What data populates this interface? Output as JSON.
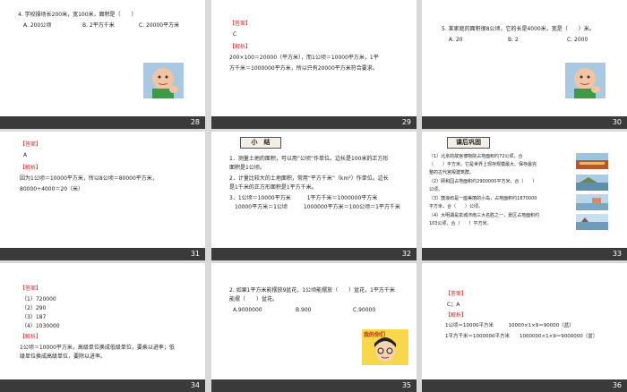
{
  "slides": [
    {
      "number": "28",
      "lines": [
        "4. 学校操场长200米，宽100米，面积是（　　）",
        "A. 200公顷",
        "B. 2平方千米",
        "C. 20000平方米"
      ]
    },
    {
      "number": "29",
      "answer_label": "【答案】",
      "answer": "C",
      "analysis_label": "【解析】",
      "lines": [
        "200×100＝20000（平方米），而1公顷＝10000平方米，1平",
        "方千米＝1000000平方米，所以只有20000平方米符合要求。"
      ]
    },
    {
      "number": "30",
      "lines": [
        "5. 某家庭的面积很8公顷，它的长是4000米，宽是（　　）米。",
        "A. 20",
        "B. 2",
        "C. 2000"
      ]
    },
    {
      "number": "31",
      "answer_label": "【答案】",
      "answer": "A",
      "analysis_label": "【解析】",
      "lines": [
        "因为1公顷＝10000平方米，所以8公顷＝80000平方米，",
        "80000÷4000＝20（米）"
      ]
    },
    {
      "number": "32",
      "title": "小　结",
      "lines": [
        "1．测量土地的面积，可以用“公顷”作单位。边长是100米的正方形",
        "面积是1公顷。",
        "2．计量比较大的土地面积，常用“平方千米”（km²）作单位。边长",
        "是1千米的正方形面积是1平方千米。",
        "3．1公顷＝10000平方米　　　1平方千米＝1000000平方米",
        "　10000平方米＝1公顷　　　1000000平方米＝100公顷＝1平方千米"
      ]
    },
    {
      "number": "33",
      "title": "课后巩固",
      "lines": [
        "（1）北京的故宫博物院占地面积约72公顷，合",
        "（　　）平方米。它是世界上现存规模最大、保存最完",
        "整的古代宫殿建筑群。",
        "（2）颐和园占地面积约2900000平方米，合（　　）",
        "公顷。",
        "（3）鼓浪屿是一座美丽的小岛，占地面积约1870000",
        "平方米，合（　　）公顷。",
        "（4）大明湖是泉城济南三大名胜之一，景区占地面积约",
        "103公顷，合（　　）平方米。"
      ]
    },
    {
      "number": "34",
      "answer_label": "【答案】",
      "analysis_label": "【解析】",
      "answers": [
        "（1）720000",
        "（2）290",
        "（3）187",
        "（4）1030000"
      ],
      "lines": [
        "1公顷＝10000平方米，高级单位换成低级单位，要乘以进率；低",
        "级单位换成高级单位，要除以进率。"
      ]
    },
    {
      "number": "35",
      "sticker_text": "我的你们",
      "lines": [
        "2. 如果1平方米能摆放9盆花，1公顷能摆放（　　）盆花，1平方千米",
        "能摆（　　）盆花。",
        "A.9000000",
        "B.900",
        "C.90000"
      ]
    },
    {
      "number": "36",
      "answer_label": "【答案】",
      "answer": "C；A",
      "analysis_label": "【解析】",
      "lines": [
        "1公顷＝10000平方米　　　10000×1×9＝90000（盆）",
        "1平方千米＝1000000平方米　　1000000×1×9＝9000000（盆）"
      ]
    }
  ]
}
